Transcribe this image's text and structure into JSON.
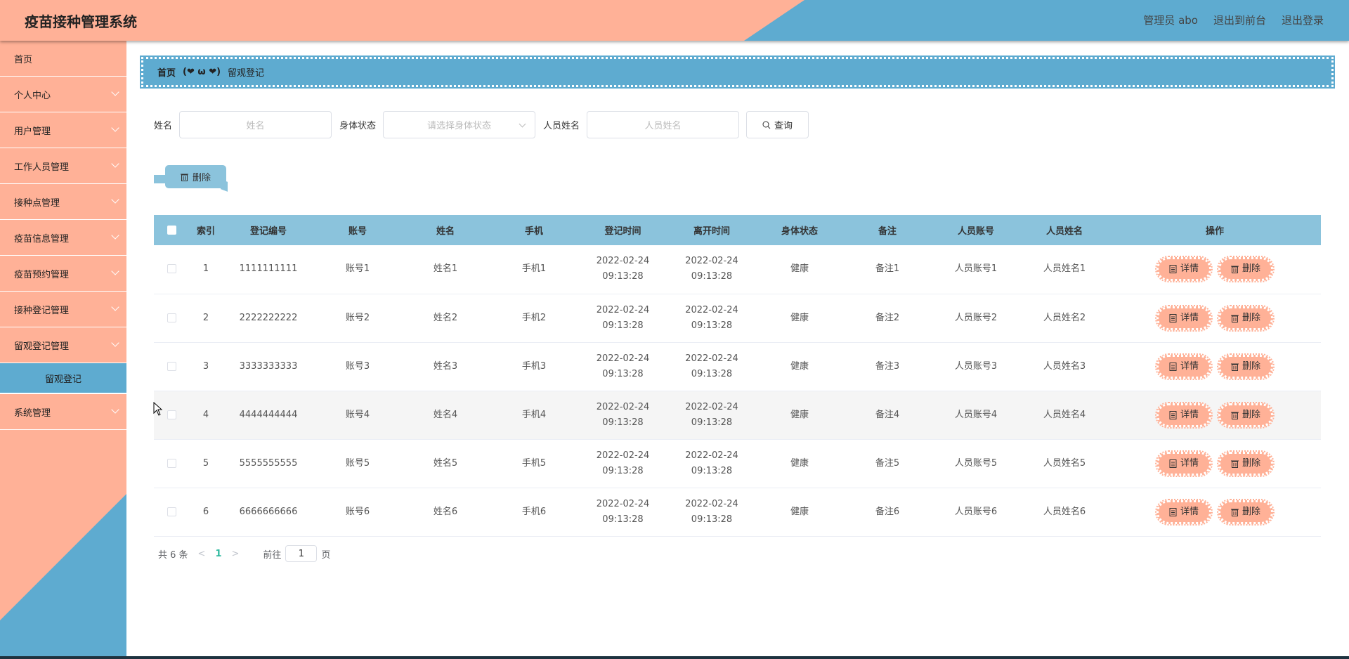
{
  "header": {
    "title": "疫苗接种管理系统",
    "user": "管理员 abo",
    "to_front": "退出到前台",
    "logout": "退出登录"
  },
  "colors": {
    "salmon": "#ffb197",
    "blue": "#5eabd0",
    "table_header": "#8bc3dc"
  },
  "sidebar": {
    "items": [
      {
        "label": "首页"
      },
      {
        "label": "个人中心"
      },
      {
        "label": "用户管理"
      },
      {
        "label": "工作人员管理"
      },
      {
        "label": "接种点管理"
      },
      {
        "label": "疫苗信息管理"
      },
      {
        "label": "疫苗预约管理"
      },
      {
        "label": "接种登记管理"
      },
      {
        "label": "留观登记管理"
      }
    ],
    "active_sub": "留观登记",
    "last": "系统管理"
  },
  "breadcrumb": {
    "home": "首页",
    "sep": "(❤ ω ❤)",
    "current": "留观登记"
  },
  "search": {
    "name_label": "姓名",
    "name_placeholder": "姓名",
    "status_label": "身体状态",
    "status_placeholder": "请选择身体状态",
    "staff_label": "人员姓名",
    "staff_placeholder": "人员姓名",
    "query": "查询"
  },
  "toolbar": {
    "delete": "删除"
  },
  "table": {
    "headers": [
      "索引",
      "登记编号",
      "账号",
      "姓名",
      "手机",
      "登记时间",
      "离开时间",
      "身体状态",
      "备注",
      "人员账号",
      "人员姓名",
      "操作"
    ],
    "rows": [
      [
        "1",
        "1111111111",
        "账号1",
        "姓名1",
        "手机1",
        "2022-02-24 09:13:28",
        "2022-02-24 09:13:28",
        "健康",
        "备注1",
        "人员账号1",
        "人员姓名1"
      ],
      [
        "2",
        "2222222222",
        "账号2",
        "姓名2",
        "手机2",
        "2022-02-24 09:13:28",
        "2022-02-24 09:13:28",
        "健康",
        "备注2",
        "人员账号2",
        "人员姓名2"
      ],
      [
        "3",
        "3333333333",
        "账号3",
        "姓名3",
        "手机3",
        "2022-02-24 09:13:28",
        "2022-02-24 09:13:28",
        "健康",
        "备注3",
        "人员账号3",
        "人员姓名3"
      ],
      [
        "4",
        "4444444444",
        "账号4",
        "姓名4",
        "手机4",
        "2022-02-24 09:13:28",
        "2022-02-24 09:13:28",
        "健康",
        "备注4",
        "人员账号4",
        "人员姓名4"
      ],
      [
        "5",
        "5555555555",
        "账号5",
        "姓名5",
        "手机5",
        "2022-02-24 09:13:28",
        "2022-02-24 09:13:28",
        "健康",
        "备注5",
        "人员账号5",
        "人员姓名5"
      ],
      [
        "6",
        "6666666666",
        "账号6",
        "姓名6",
        "手机6",
        "2022-02-24 09:13:28",
        "2022-02-24 09:13:28",
        "健康",
        "备注6",
        "人员账号6",
        "人员姓名6"
      ]
    ],
    "detail": "详情",
    "delete": "删除"
  },
  "pagination": {
    "total": "共 6 条",
    "current": "1",
    "goto": "前往",
    "page_value": "1",
    "page_suffix": "页"
  }
}
